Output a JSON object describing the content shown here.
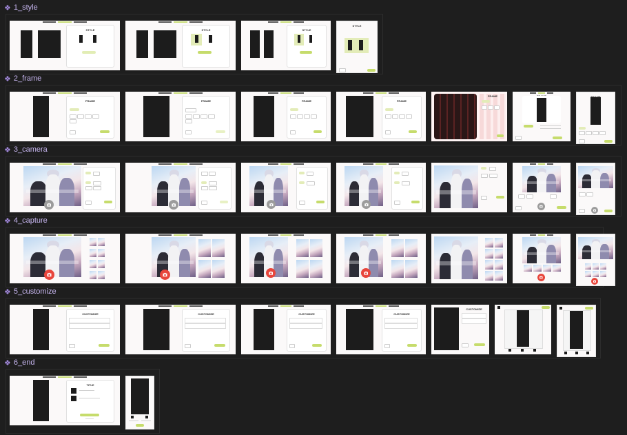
{
  "sections": [
    {
      "key": "style",
      "label": "1_style"
    },
    {
      "key": "frame",
      "label": "2_frame"
    },
    {
      "key": "camera",
      "label": "3_camera"
    },
    {
      "key": "capture",
      "label": "4_capture"
    },
    {
      "key": "customize",
      "label": "5_customize"
    },
    {
      "key": "end",
      "label": "6_end"
    }
  ],
  "titles": {
    "style": "STYLE",
    "frame": "FRAME",
    "customize": "CUSTOMIZE",
    "end": "TITLE"
  },
  "colors": {
    "canvas": "#1e1e1e",
    "label": "#c7b6f0",
    "accent": "#c6dc6c",
    "capture_button": "#e8463c"
  },
  "icons": {
    "section": "component-diamond-icon",
    "camera": "camera-icon"
  }
}
